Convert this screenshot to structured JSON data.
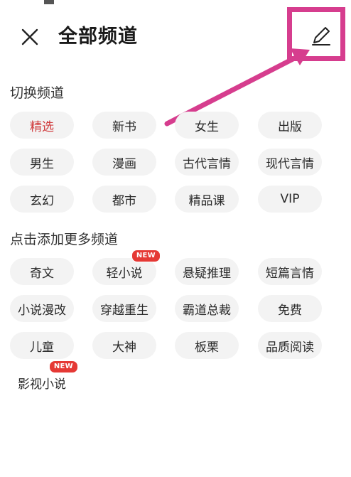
{
  "header": {
    "title": "全部频道",
    "close_icon": "close-icon",
    "edit_icon": "pencil-icon"
  },
  "colors": {
    "accent": "#d0393b",
    "highlight": "#d63d8e",
    "chip_bg": "#f3f3f3",
    "badge": "#e53935"
  },
  "switch_section": {
    "title": "切换频道",
    "channels": [
      {
        "label": "精选",
        "selected": true
      },
      {
        "label": "新书"
      },
      {
        "label": "女生"
      },
      {
        "label": "出版"
      },
      {
        "label": "男生"
      },
      {
        "label": "漫画"
      },
      {
        "label": "古代言情"
      },
      {
        "label": "现代言情"
      },
      {
        "label": "玄幻"
      },
      {
        "label": "都市"
      },
      {
        "label": "精品课"
      },
      {
        "label": "VIP"
      }
    ]
  },
  "add_section": {
    "title": "点击添加更多频道",
    "channels": [
      {
        "label": "奇文"
      },
      {
        "label": "轻小说",
        "badge": "NEW"
      },
      {
        "label": "悬疑推理"
      },
      {
        "label": "短篇言情"
      },
      {
        "label": "小说漫改"
      },
      {
        "label": "穿越重生"
      },
      {
        "label": "霸道总裁"
      },
      {
        "label": "免费"
      },
      {
        "label": "儿童"
      },
      {
        "label": "大神"
      },
      {
        "label": "板栗"
      },
      {
        "label": "品质阅读"
      },
      {
        "label": "影视小说",
        "badge": "NEW"
      }
    ]
  }
}
